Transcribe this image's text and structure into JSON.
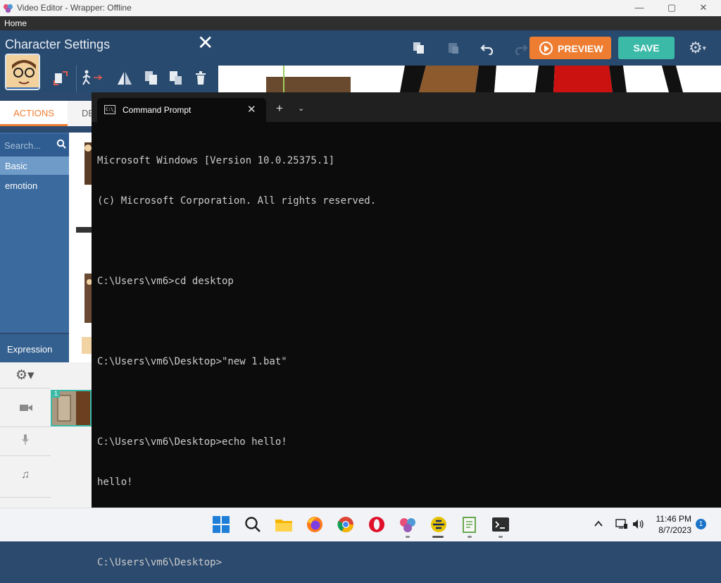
{
  "window": {
    "title": "Video Editor - Wrapper: Offline",
    "controls": {
      "minimize": "—",
      "maximize": "▢",
      "close": "✕"
    }
  },
  "menu": {
    "home": "Home"
  },
  "toolbar": {
    "preview_label": "PREVIEW",
    "save_label": "SAVE"
  },
  "character_panel": {
    "title": "Character Settings",
    "close": "✕",
    "tabs": {
      "actions": "ACTIONS",
      "second_partial": "DE"
    },
    "search_placeholder": "Search...",
    "categories": [
      "Basic",
      "emotion"
    ],
    "expression": "Expression"
  },
  "timeline": {
    "scene_number": "1",
    "gear": "⚙▾",
    "note": "♫"
  },
  "terminal": {
    "tab_title": "Command Prompt",
    "tab_icon_text": "C:\\_",
    "tab_close": "✕",
    "new_tab": "+",
    "dropdown": "⌄",
    "lines": [
      "Microsoft Windows [Version 10.0.25375.1]",
      "(c) Microsoft Corporation. All rights reserved.",
      "",
      "C:\\Users\\vm6>cd desktop",
      "",
      "C:\\Users\\vm6\\Desktop>\"new 1.bat\"",
      "",
      "C:\\Users\\vm6\\Desktop>echo hello!",
      "hello!",
      "",
      "C:\\Users\\vm6\\Desktop>"
    ]
  },
  "taskbar": {
    "apps": [
      "start",
      "search",
      "file-explorer",
      "firefox",
      "chrome",
      "opera",
      "wrapper",
      "app-yellow",
      "app-notepad",
      "terminal"
    ],
    "time": "11:46 PM",
    "date": "8/7/2023",
    "notifications": "1"
  },
  "colors": {
    "accent_orange": "#ee7d31",
    "save_teal": "#3bbaa8",
    "panel_blue": "#294a6f"
  }
}
